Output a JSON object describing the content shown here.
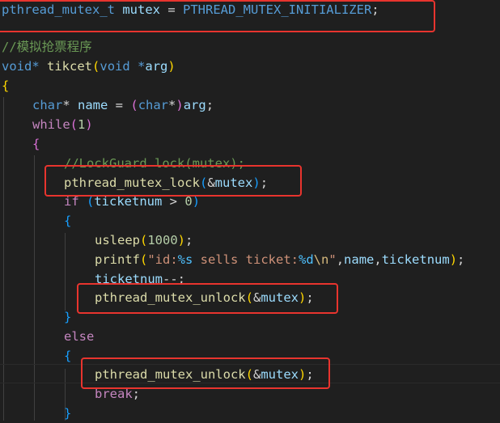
{
  "code": {
    "line1": {
      "type": "pthread_mutex_t",
      "var": "mutex",
      "eq": " = ",
      "init": "PTHREAD_MUTEX_INITIALIZER",
      "semi": ";"
    },
    "line2": {
      "comment": "//模拟抢票程序"
    },
    "line3": {
      "ret": "void*",
      "name": "tikcet",
      "open": "(",
      "ptype": "void",
      "star": " *",
      "param": "arg",
      "close": ")"
    },
    "line4": {
      "brace": "{"
    },
    "line5": {
      "type": "char",
      "star": "*",
      "var": "name",
      "eq": " = ",
      "open": "(",
      "ctype": "char",
      "cstar": "*",
      "close": ")",
      "arg": "arg",
      "semi": ";"
    },
    "line6": {
      "kw": "while",
      "open": "(",
      "num": "1",
      "close": ")"
    },
    "line7": {
      "brace": "{"
    },
    "line8": {
      "comment": "//LockGuard lock(mutex);"
    },
    "line9": {
      "func": "pthread_mutex_lock",
      "open": "(",
      "amp": "&",
      "var": "mutex",
      "close": ")",
      "semi": ";"
    },
    "line10": {
      "kw": "if",
      "open": " (",
      "var": "ticketnum",
      "gt": " > ",
      "num": "0",
      "close": ")"
    },
    "line11": {
      "brace": "{"
    },
    "line12": {
      "func": "usleep",
      "open": "(",
      "num": "1000",
      "close": ")",
      "semi": ";"
    },
    "line13": {
      "func": "printf",
      "open": "(",
      "str1": "\"id:",
      "fmt1": "%s",
      "str2": " sells ticket:",
      "fmt2": "%d",
      "esc": "\\n",
      "str3": "\"",
      "comma1": ",",
      "a1": "name",
      "comma2": ",",
      "a2": "ticketnum",
      "close": ")",
      "semi": ";"
    },
    "line14": {
      "var": "ticketnum",
      "op": "--",
      "semi": ";"
    },
    "line15": {
      "func": "pthread_mutex_unlock",
      "open": "(",
      "amp": "&",
      "var": "mutex",
      "close": ")",
      "semi": ";"
    },
    "line16": {
      "brace": "}"
    },
    "line17": {
      "kw": "else"
    },
    "line18": {
      "brace": "{"
    },
    "line19": {
      "func": "pthread_mutex_unlock",
      "open": "(",
      "amp": "&",
      "var": "mutex",
      "close": ")",
      "semi": ";"
    },
    "line20": {
      "kw": "break",
      "semi": ";"
    },
    "line21": {
      "brace": "}"
    }
  },
  "colors": {
    "highlight_box": "#e8342e",
    "background": "#1f1f1f"
  }
}
